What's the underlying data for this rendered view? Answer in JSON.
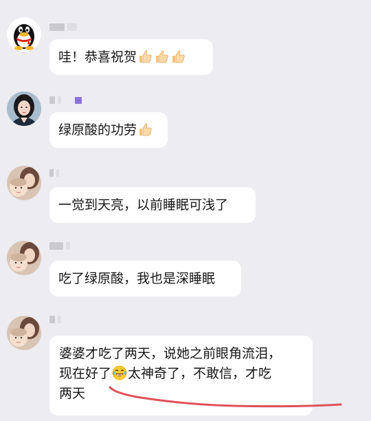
{
  "messages": [
    {
      "avatar": "penguin-avatar",
      "text_before": "哇！恭喜祝贺",
      "emojis": [
        "thumbs-up-icon",
        "thumbs-up-icon",
        "thumbs-up-icon"
      ],
      "text_after": ""
    },
    {
      "avatar": "woman-portrait-avatar",
      "text_before": "绿原酸的功劳",
      "emojis": [
        "thumbs-up-icon"
      ],
      "text_after": ""
    },
    {
      "avatar": "mother-baby-avatar",
      "text": "一觉到天亮，以前睡眠可浅了"
    },
    {
      "avatar": "mother-baby-avatar",
      "text": "吃了绿原酸，我也是深睡眠"
    },
    {
      "avatar": "mother-baby-avatar",
      "line1": "婆婆才吃了两天，说她之前眼角流泪，",
      "line2_before": "现在好了",
      "line2_emoji": "laughing-tears-icon",
      "line2_after": "太神奇了，不敢信，才吃",
      "line3": "两天"
    }
  ],
  "colors": {
    "background": "#ececf1",
    "bubble": "#ffffff",
    "annotation_line": "#e0505a",
    "name_mark": "#8a73d8"
  }
}
